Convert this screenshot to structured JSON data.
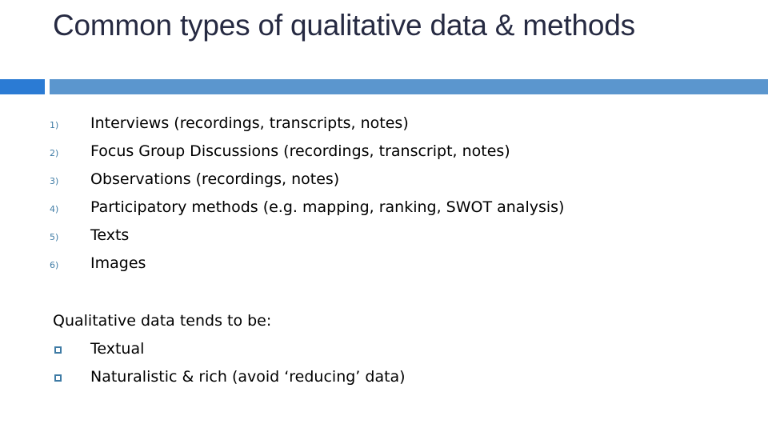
{
  "slide": {
    "title": "Common types of qualitative data & methods",
    "background_color": "#ffffff",
    "title_color": "#262a42"
  },
  "divider": {
    "block_color": "#2b7bd4",
    "rule_color": "#5b96ce"
  },
  "numbered_list": {
    "marker_color": "#3f7ba5",
    "items": [
      {
        "marker": "1)",
        "text": "Interviews (recordings, transcripts, notes)"
      },
      {
        "marker": "2)",
        "text": "Focus Group Discussions (recordings, transcript, notes)"
      },
      {
        "marker": "3)",
        "text": "Observations (recordings, notes)"
      },
      {
        "marker": "4)",
        "text": "Participatory methods (e.g. mapping, ranking, SWOT analysis)"
      },
      {
        "marker": "5)",
        "text": "Texts"
      },
      {
        "marker": "6)",
        "text": "Images"
      }
    ]
  },
  "lower_section": {
    "lead_line": "Qualitative data tends to be:",
    "bullet_color": "#3f7ba5",
    "items": [
      {
        "text": "Textual"
      },
      {
        "text": "Naturalistic & rich (avoid ‘reducing’ data)"
      }
    ]
  }
}
